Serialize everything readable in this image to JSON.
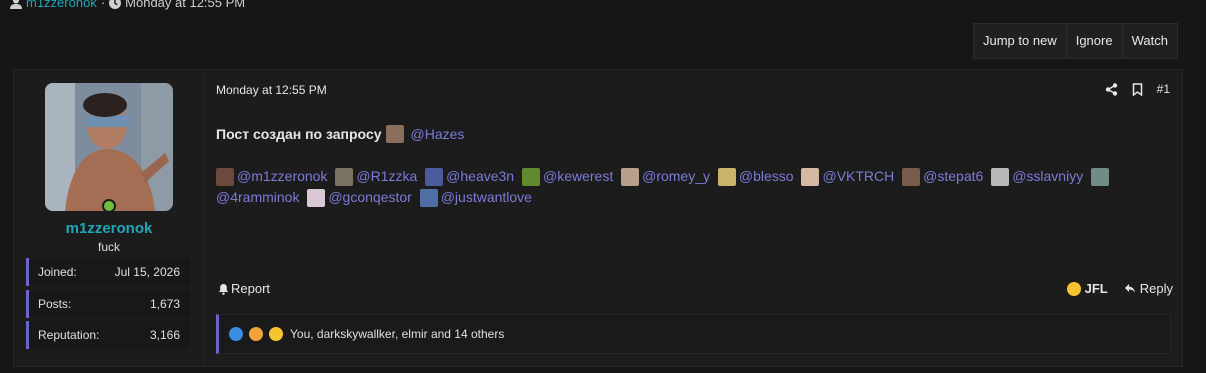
{
  "thread_meta": {
    "author": "m1zzeronok",
    "separator": "·",
    "time": "Monday at 12:55 PM"
  },
  "actions": {
    "jump": "Jump to new",
    "ignore": "Ignore",
    "watch": "Watch"
  },
  "user": {
    "name": "m1zzeronok",
    "title": "fuck",
    "stats": [
      {
        "label": "Joined:",
        "value": "Jul 15, 2026"
      },
      {
        "label": "Posts:",
        "value": "1,673"
      },
      {
        "label": "Reputation:",
        "value": "3,166"
      }
    ]
  },
  "post": {
    "date": "Monday at 12:55 PM",
    "number": "#1",
    "intro_text": "Пост создан по запросу",
    "intro_mention": "@Hazes",
    "mentions": [
      "@m1zzeronok",
      "@R1zzka",
      "@heave3n",
      "@kewerest",
      "@romey_y",
      "@blesso",
      "@VKTRCH",
      "@stepat6",
      "@sslavniyy",
      "@4ramminok",
      "@gconqestor",
      "@justwantlove"
    ],
    "report": "Report",
    "jfl": "JFL",
    "reply": "Reply",
    "reactions_text": "You, darkskywallker, elmir and 14 others"
  },
  "colors": {
    "accent": "#6a66c9",
    "username": "#1fa7b8",
    "mention": "#7b7bd8",
    "online": "#6fbf3f"
  }
}
